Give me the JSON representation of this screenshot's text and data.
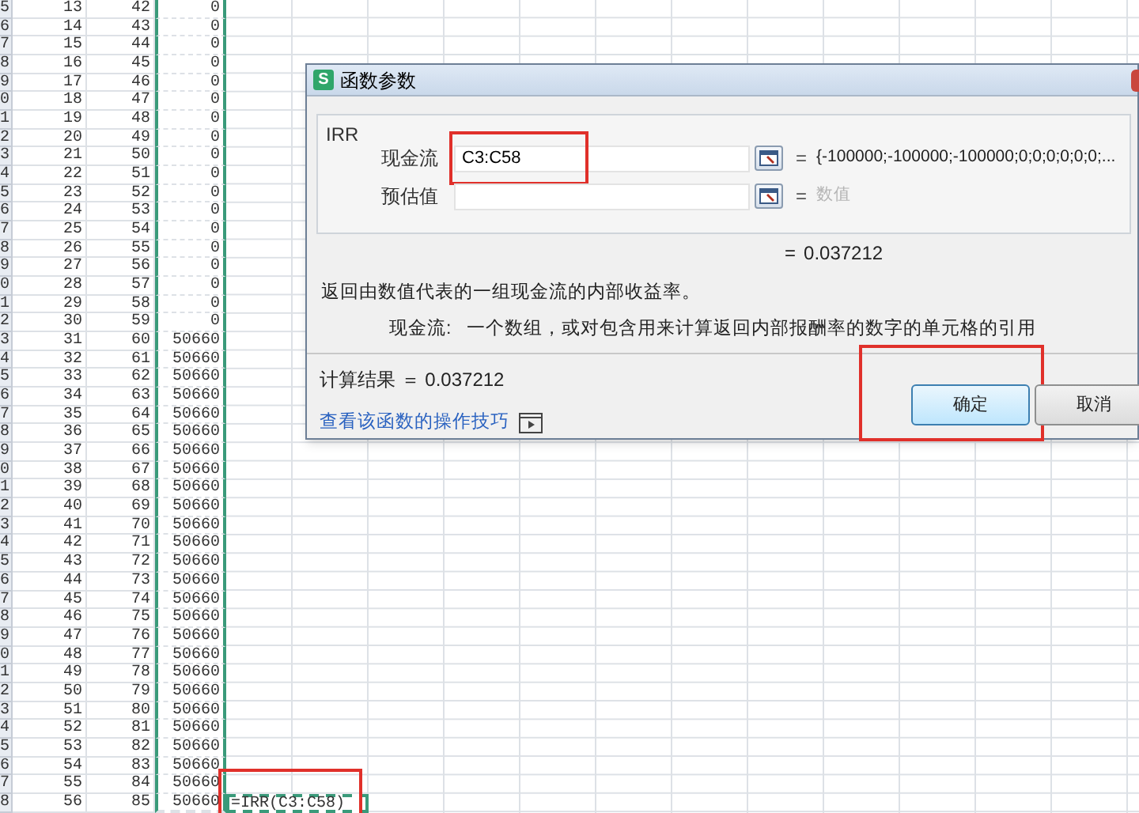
{
  "sheet": {
    "rows": [
      {
        "row_label": "5",
        "col_b": "13",
        "col_c": "42",
        "col_d": "0"
      },
      {
        "row_label": "6",
        "col_b": "14",
        "col_c": "43",
        "col_d": "0"
      },
      {
        "row_label": "7",
        "col_b": "15",
        "col_c": "44",
        "col_d": "0"
      },
      {
        "row_label": "8",
        "col_b": "16",
        "col_c": "45",
        "col_d": "0"
      },
      {
        "row_label": "9",
        "col_b": "17",
        "col_c": "46",
        "col_d": "0"
      },
      {
        "row_label": "0",
        "col_b": "18",
        "col_c": "47",
        "col_d": "0"
      },
      {
        "row_label": "1",
        "col_b": "19",
        "col_c": "48",
        "col_d": "0"
      },
      {
        "row_label": "2",
        "col_b": "20",
        "col_c": "49",
        "col_d": "0"
      },
      {
        "row_label": "3",
        "col_b": "21",
        "col_c": "50",
        "col_d": "0"
      },
      {
        "row_label": "4",
        "col_b": "22",
        "col_c": "51",
        "col_d": "0"
      },
      {
        "row_label": "5",
        "col_b": "23",
        "col_c": "52",
        "col_d": "0"
      },
      {
        "row_label": "6",
        "col_b": "24",
        "col_c": "53",
        "col_d": "0"
      },
      {
        "row_label": "7",
        "col_b": "25",
        "col_c": "54",
        "col_d": "0"
      },
      {
        "row_label": "8",
        "col_b": "26",
        "col_c": "55",
        "col_d": "0"
      },
      {
        "row_label": "9",
        "col_b": "27",
        "col_c": "56",
        "col_d": "0"
      },
      {
        "row_label": "0",
        "col_b": "28",
        "col_c": "57",
        "col_d": "0"
      },
      {
        "row_label": "1",
        "col_b": "29",
        "col_c": "58",
        "col_d": "0"
      },
      {
        "row_label": "2",
        "col_b": "30",
        "col_c": "59",
        "col_d": "0"
      },
      {
        "row_label": "3",
        "col_b": "31",
        "col_c": "60",
        "col_d": "50660"
      },
      {
        "row_label": "4",
        "col_b": "32",
        "col_c": "61",
        "col_d": "50660"
      },
      {
        "row_label": "5",
        "col_b": "33",
        "col_c": "62",
        "col_d": "50660"
      },
      {
        "row_label": "6",
        "col_b": "34",
        "col_c": "63",
        "col_d": "50660"
      },
      {
        "row_label": "7",
        "col_b": "35",
        "col_c": "64",
        "col_d": "50660"
      },
      {
        "row_label": "8",
        "col_b": "36",
        "col_c": "65",
        "col_d": "50660"
      },
      {
        "row_label": "9",
        "col_b": "37",
        "col_c": "66",
        "col_d": "50660"
      },
      {
        "row_label": "0",
        "col_b": "38",
        "col_c": "67",
        "col_d": "50660"
      },
      {
        "row_label": "1",
        "col_b": "39",
        "col_c": "68",
        "col_d": "50660"
      },
      {
        "row_label": "2",
        "col_b": "40",
        "col_c": "69",
        "col_d": "50660"
      },
      {
        "row_label": "3",
        "col_b": "41",
        "col_c": "70",
        "col_d": "50660"
      },
      {
        "row_label": "4",
        "col_b": "42",
        "col_c": "71",
        "col_d": "50660"
      },
      {
        "row_label": "5",
        "col_b": "43",
        "col_c": "72",
        "col_d": "50660"
      },
      {
        "row_label": "6",
        "col_b": "44",
        "col_c": "73",
        "col_d": "50660"
      },
      {
        "row_label": "7",
        "col_b": "45",
        "col_c": "74",
        "col_d": "50660"
      },
      {
        "row_label": "8",
        "col_b": "46",
        "col_c": "75",
        "col_d": "50660"
      },
      {
        "row_label": "9",
        "col_b": "47",
        "col_c": "76",
        "col_d": "50660"
      },
      {
        "row_label": "0",
        "col_b": "48",
        "col_c": "77",
        "col_d": "50660"
      },
      {
        "row_label": "1",
        "col_b": "49",
        "col_c": "78",
        "col_d": "50660"
      },
      {
        "row_label": "2",
        "col_b": "50",
        "col_c": "79",
        "col_d": "50660"
      },
      {
        "row_label": "3",
        "col_b": "51",
        "col_c": "80",
        "col_d": "50660"
      },
      {
        "row_label": "4",
        "col_b": "52",
        "col_c": "81",
        "col_d": "50660"
      },
      {
        "row_label": "5",
        "col_b": "53",
        "col_c": "82",
        "col_d": "50660"
      },
      {
        "row_label": "6",
        "col_b": "54",
        "col_c": "83",
        "col_d": "50660"
      },
      {
        "row_label": "7",
        "col_b": "55",
        "col_c": "84",
        "col_d": "50660"
      },
      {
        "row_label": "8",
        "col_b": "56",
        "col_c": "85",
        "col_d": "50660",
        "col_e": "=IRR(C3:C58)",
        "selected": true,
        "highlighted": true
      }
    ]
  },
  "dialog": {
    "title": "函数参数",
    "app_icon_letter": "S",
    "group_label": "IRR",
    "params": [
      {
        "label": "现金流",
        "value": "C3:C58",
        "equals": "=",
        "result": "{-100000;-100000;-100000;0;0;0;0;0;0;...",
        "result_is_hint": false,
        "highlighted": true
      },
      {
        "label": "预估值",
        "equals": "=",
        "result": "数值",
        "result_is_hint": true,
        "highlighted": false
      }
    ],
    "formula_equals": "=",
    "formula_result": "0.037212",
    "description": "返回由数值代表的一组现金流的内部收益率。",
    "arg_name": "现金流:",
    "arg_help": "一个数组，或对包含用来计算返回内部报酬率的数字的单元格的引用",
    "calc_result": "计算结果 ＝ 0.037212",
    "help_link": "查看该函数的操作技巧",
    "buttons": [
      {
        "label": "确定",
        "kind": "primary",
        "highlighted": true
      },
      {
        "label": "取消",
        "kind": "secondary",
        "highlighted": false
      }
    ]
  }
}
